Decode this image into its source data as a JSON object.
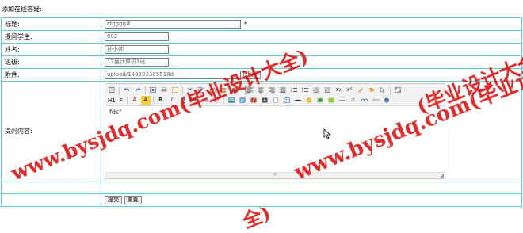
{
  "page": {
    "title": "添加在线答疑:"
  },
  "form": {
    "title_label": "标题:",
    "title_value": "sfgggg#",
    "required_mark": "*",
    "student_label": "提问学生:",
    "student_value": "002",
    "name_label": "姓名:",
    "name_value": "孙小帅",
    "class_label": "班级:",
    "class_value": "17届计算机1班",
    "attachment_label": "附件:",
    "attachment_value": "upload/149203305518d",
    "upload_button": "上传",
    "content_label": "提问内容:",
    "content_value": "fdsf",
    "submit_button": "提交",
    "reset_button": "重置"
  },
  "toolbar": {
    "row1": [
      "source-icon",
      "undo-icon",
      "redo-icon",
      "preview-icon",
      "print-icon",
      "template-icon",
      "cut-icon",
      "copy-icon",
      "paste-icon",
      "paste-text-icon",
      "paste-word-icon",
      "align-left-icon",
      "align-center-icon",
      "align-right-icon",
      "align-justify-icon",
      "ordered-list-icon",
      "unordered-list-icon",
      "indent-icon",
      "outdent-icon",
      "subscript-icon",
      "superscript-icon",
      "clear-format-icon",
      "format-painter-icon",
      "select-all-icon",
      "fullscreen-icon"
    ],
    "heading_label": "H1",
    "font_family_label": "F",
    "font_color_label": "A",
    "bg_color_label": "A",
    "bold_label": "B",
    "italic_label": "I",
    "underline_label": "U",
    "strike_label": "ABC",
    "row2": [
      "lineheight-icon",
      "eraser-icon",
      "image-icon",
      "multi-image-icon",
      "flash-icon",
      "media-icon",
      "insert-file-icon",
      "table-icon",
      "horizontal-rule-icon",
      "emoticon-icon",
      "baidu-map-icon",
      "code-icon",
      "page-break-icon",
      "anchor-icon",
      "link-icon",
      "unlink-icon",
      "about-icon"
    ]
  },
  "watermark": {
    "text_full": "www.bysjdq.com(毕业设计大全)",
    "text_partial": "(毕业设计大全)",
    "text_char": "全)"
  },
  "colors": {
    "border": "#5fd0d0",
    "watermark": "#e11919"
  }
}
